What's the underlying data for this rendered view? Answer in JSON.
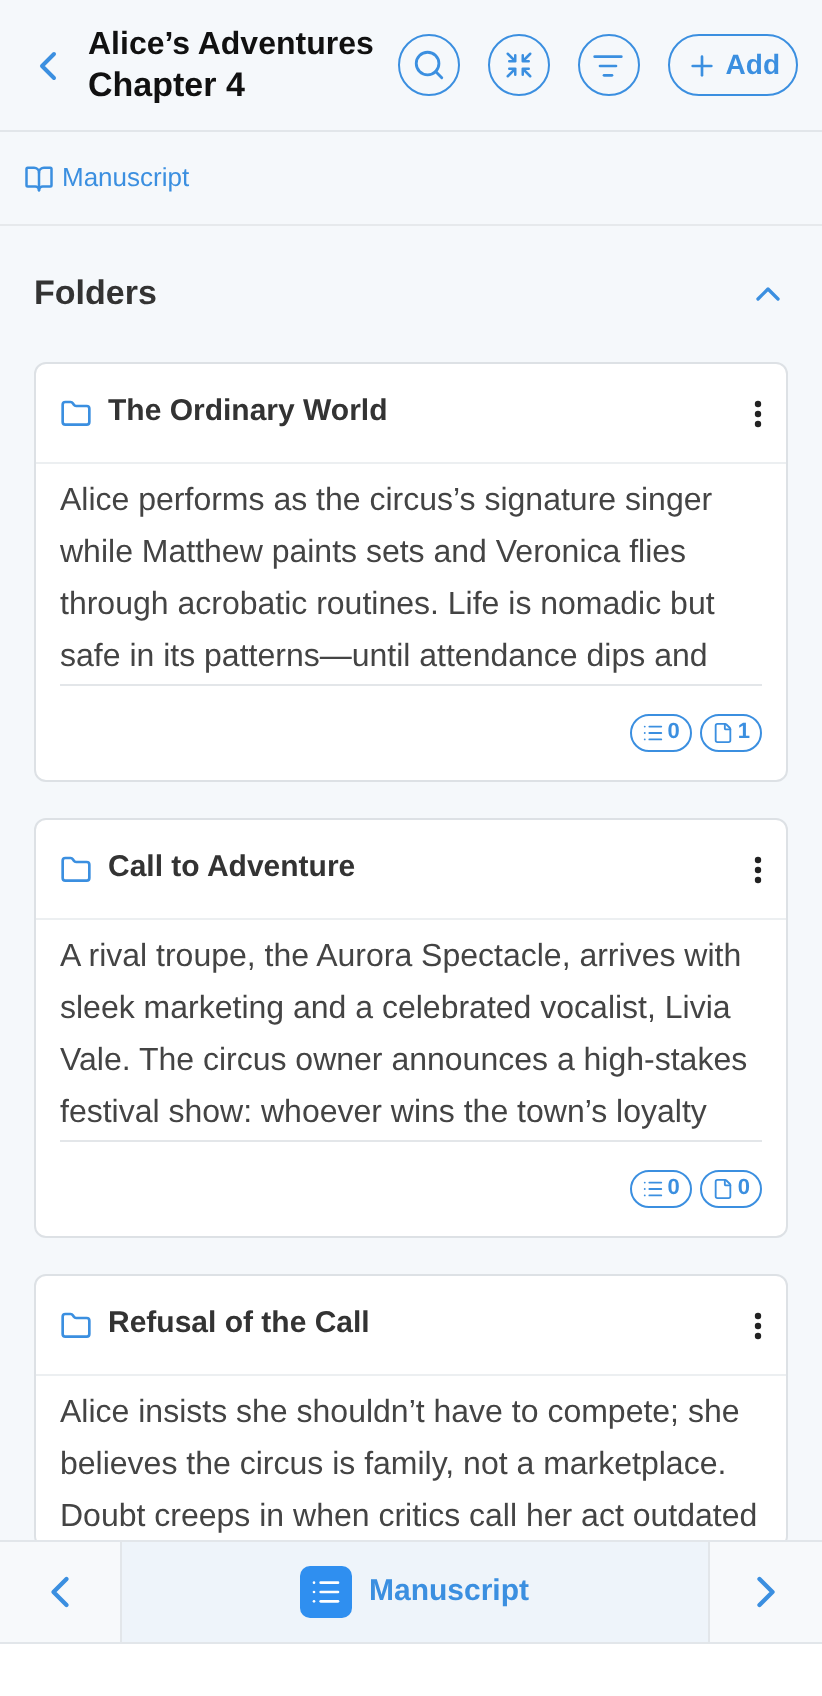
{
  "header": {
    "title_line_1": "Alice’s Adventures",
    "title_line_2": "Chapter 4",
    "add_button": "Add"
  },
  "breadcrumb": "Manuscript",
  "section": {
    "title": "Folders",
    "expanded": true
  },
  "folders": [
    {
      "title": "The Ordinary World",
      "summary": "Alice performs as the circus’s signature singer while Matthew paints sets and Veronica flies through acrobatic routines. Life is nomadic but safe in its patterns—until attendance dips and",
      "list_count": "0",
      "page_count": "1"
    },
    {
      "title": "Call to Adventure",
      "summary": "A rival troupe, the Aurora Spectacle, arrives with sleek marketing and a celebrated vocalist, Livia Vale. The circus owner announces a high-stakes festival show: whoever wins the town’s loyalty",
      "list_count": "0",
      "page_count": "0"
    },
    {
      "title": "Refusal of the Call",
      "summary": "Alice insists she shouldn’t have to compete; she believes the circus is family, not a marketplace. Doubt creeps in when critics call her act outdated"
    }
  ],
  "bottom_bar": {
    "label": "Manuscript"
  }
}
